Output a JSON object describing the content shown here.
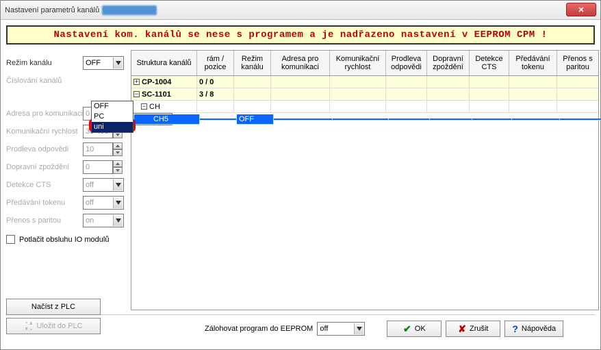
{
  "title": "Nastavení parametrů kanálů",
  "banner_text": "Nastavení kom. kanálů se nese s programem a je nadřazeno nastavení v EEPROM CPM !",
  "left": {
    "rezim_kanalu": {
      "label": "Režim kanálu",
      "value": "OFF"
    },
    "cislovani": {
      "label": "Číslování kanálů",
      "value": ""
    },
    "dropdown_opts": [
      "OFF",
      "PC",
      "uni"
    ],
    "adresa": {
      "label": "Adresa pro komunikaci",
      "value": "0"
    },
    "rychlost": {
      "label": "Komunikační rychlost",
      "value": "38 400"
    },
    "prodleva": {
      "label": "Prodleva odpovědi",
      "value": "10"
    },
    "zpozdeni": {
      "label": "Dopravní zpoždění",
      "value": "0"
    },
    "detekce": {
      "label": "Detekce CTS",
      "value": "off"
    },
    "token": {
      "label": "Předávání tokenu",
      "value": "off"
    },
    "parita": {
      "label": "Přenos s paritou",
      "value": "on"
    },
    "potlacit": "Potlačit obsluhu IO modulů",
    "load_btn": "Načíst z PLC",
    "save_btn": "Uložit do PLC"
  },
  "headers": [
    "Struktura kanálů",
    "rám / pozice",
    "Režim kanálu",
    "Adresa pro komunikaci",
    "Komunikační rychlost",
    "Prodleva odpovědi",
    "Dopravní zpoždění",
    "Detekce CTS",
    "Předávání tokenu",
    "Přenos s paritou"
  ],
  "rows": [
    {
      "icon": "plus",
      "name": "CP-1004",
      "ram": "0 / 0",
      "rezim": "",
      "cls": "ylw",
      "indent": 0
    },
    {
      "icon": "minus",
      "name": "SC-1101",
      "ram": "3 / 8",
      "rezim": "",
      "cls": "ylw",
      "indent": 0
    },
    {
      "icon": "minus",
      "name": "CH",
      "ram": "",
      "rezim": "",
      "cls": "",
      "indent": 1
    },
    {
      "icon": "",
      "name": "CH5",
      "ram": "",
      "rezim": "OFF",
      "cls": "sel",
      "indent": 2
    }
  ],
  "footer": {
    "zaloha_label": "Zálohovat program do EEPROM",
    "zaloha_value": "off",
    "ok": "OK",
    "zrusit": "Zrušit",
    "napoveda": "Nápověda"
  }
}
